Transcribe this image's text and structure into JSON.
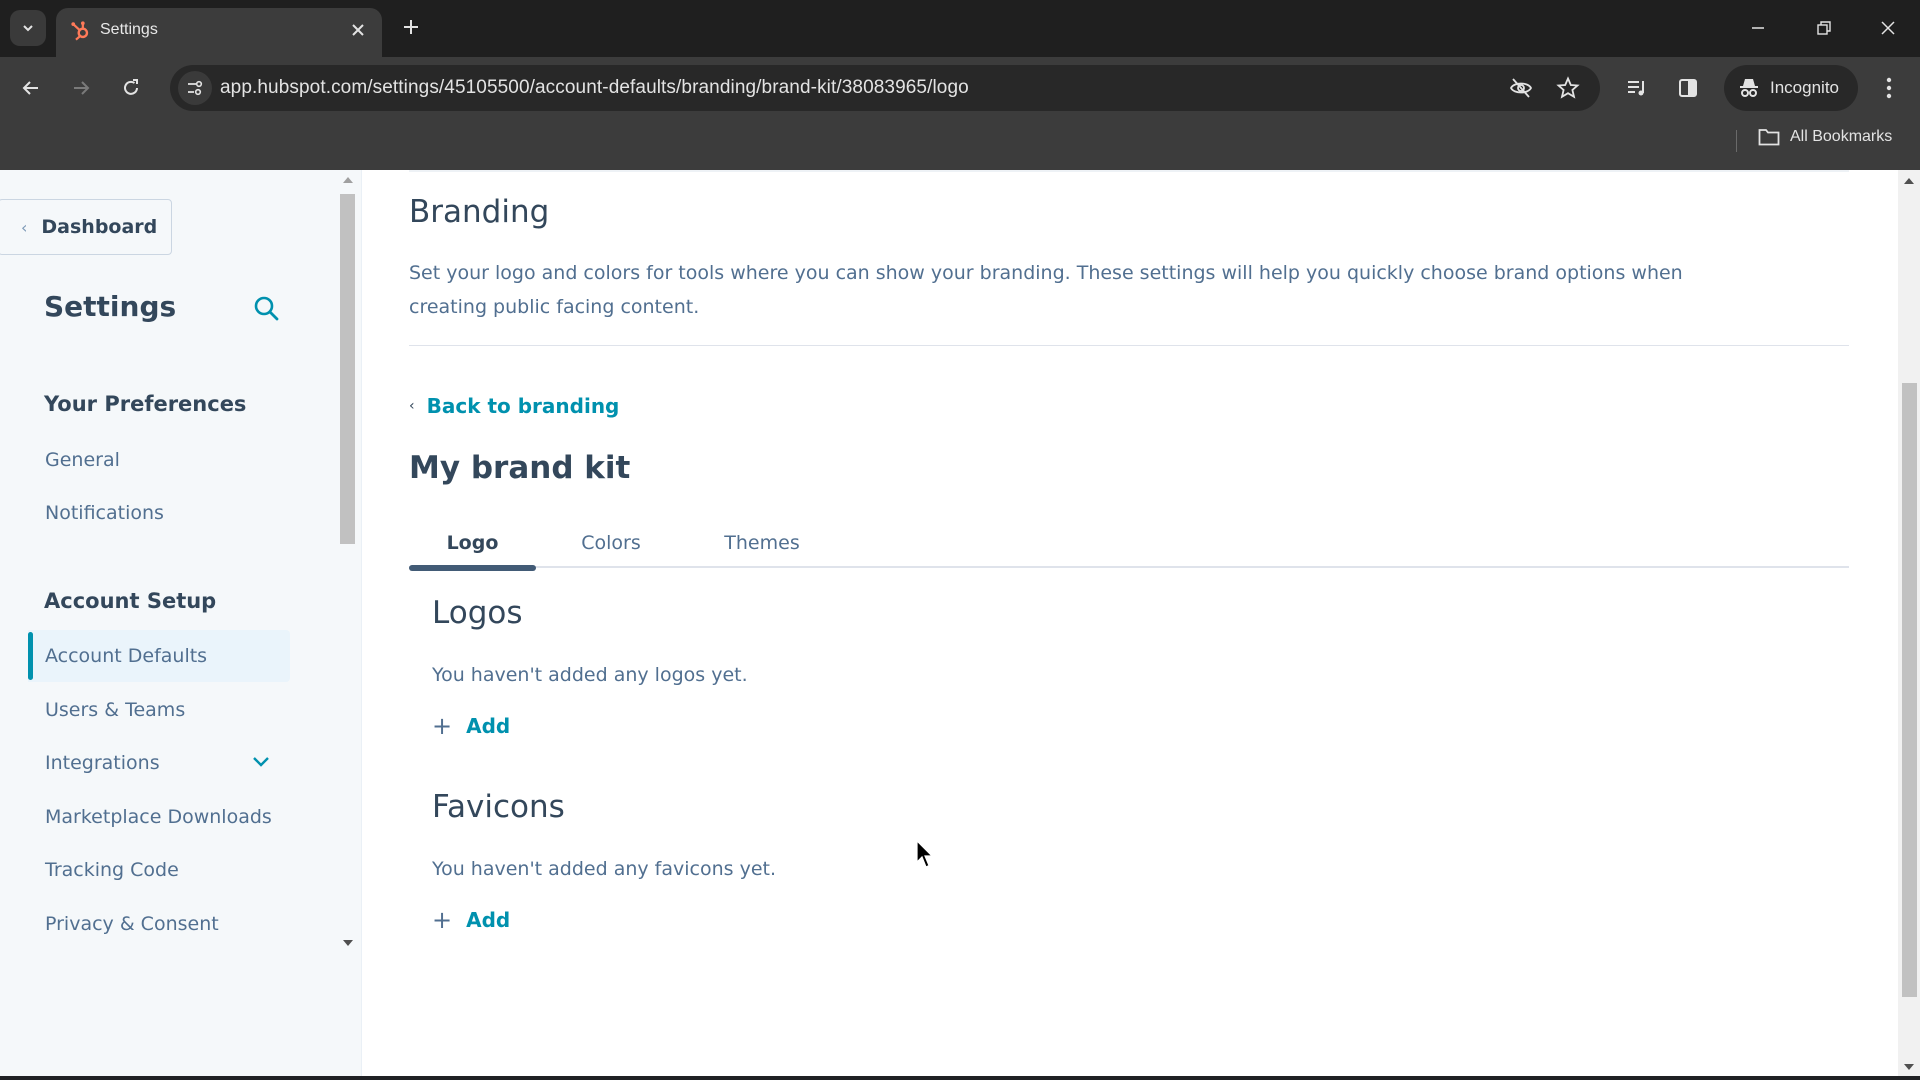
{
  "browser": {
    "tab": {
      "title": "Settings",
      "favicon": "hubspot-sprocket-icon"
    },
    "url": "app.hubspot.com/settings/45105500/account-defaults/branding/brand-kit/38083965/logo",
    "profile_label": "Incognito",
    "bookmarks_label": "All Bookmarks",
    "colors": {
      "hubspot_orange": "#ff7a59"
    }
  },
  "sidebar": {
    "back_button": "Dashboard",
    "title": "Settings",
    "sections": [
      {
        "heading": "Your Preferences",
        "items": [
          {
            "label": "General"
          },
          {
            "label": "Notifications"
          }
        ]
      },
      {
        "heading": "Account Setup",
        "items": [
          {
            "label": "Account Defaults",
            "active": true
          },
          {
            "label": "Users & Teams"
          },
          {
            "label": "Integrations",
            "expandable": true
          },
          {
            "label": "Marketplace Downloads"
          },
          {
            "label": "Tracking Code"
          },
          {
            "label": "Privacy & Consent"
          }
        ]
      }
    ]
  },
  "main": {
    "title": "Branding",
    "description": "Set your logo and colors for tools where you can show your branding. These settings will help you quickly choose brand options when creating public facing content.",
    "back_link": "Back to branding",
    "brand_kit_title": "My brand kit",
    "tabs": [
      {
        "label": "Logo",
        "active": true
      },
      {
        "label": "Colors"
      },
      {
        "label": "Themes"
      }
    ],
    "logos": {
      "title": "Logos",
      "empty_text": "You haven't added any logos yet.",
      "add_label": "Add"
    },
    "favicons": {
      "title": "Favicons",
      "empty_text": "You haven't added any favicons yet.",
      "add_label": "Add"
    }
  },
  "theme": {
    "accent": "#0091ae",
    "text_dark": "#33475b",
    "text_muted": "#516f90",
    "sidebar_bg": "#f5f8fa"
  }
}
